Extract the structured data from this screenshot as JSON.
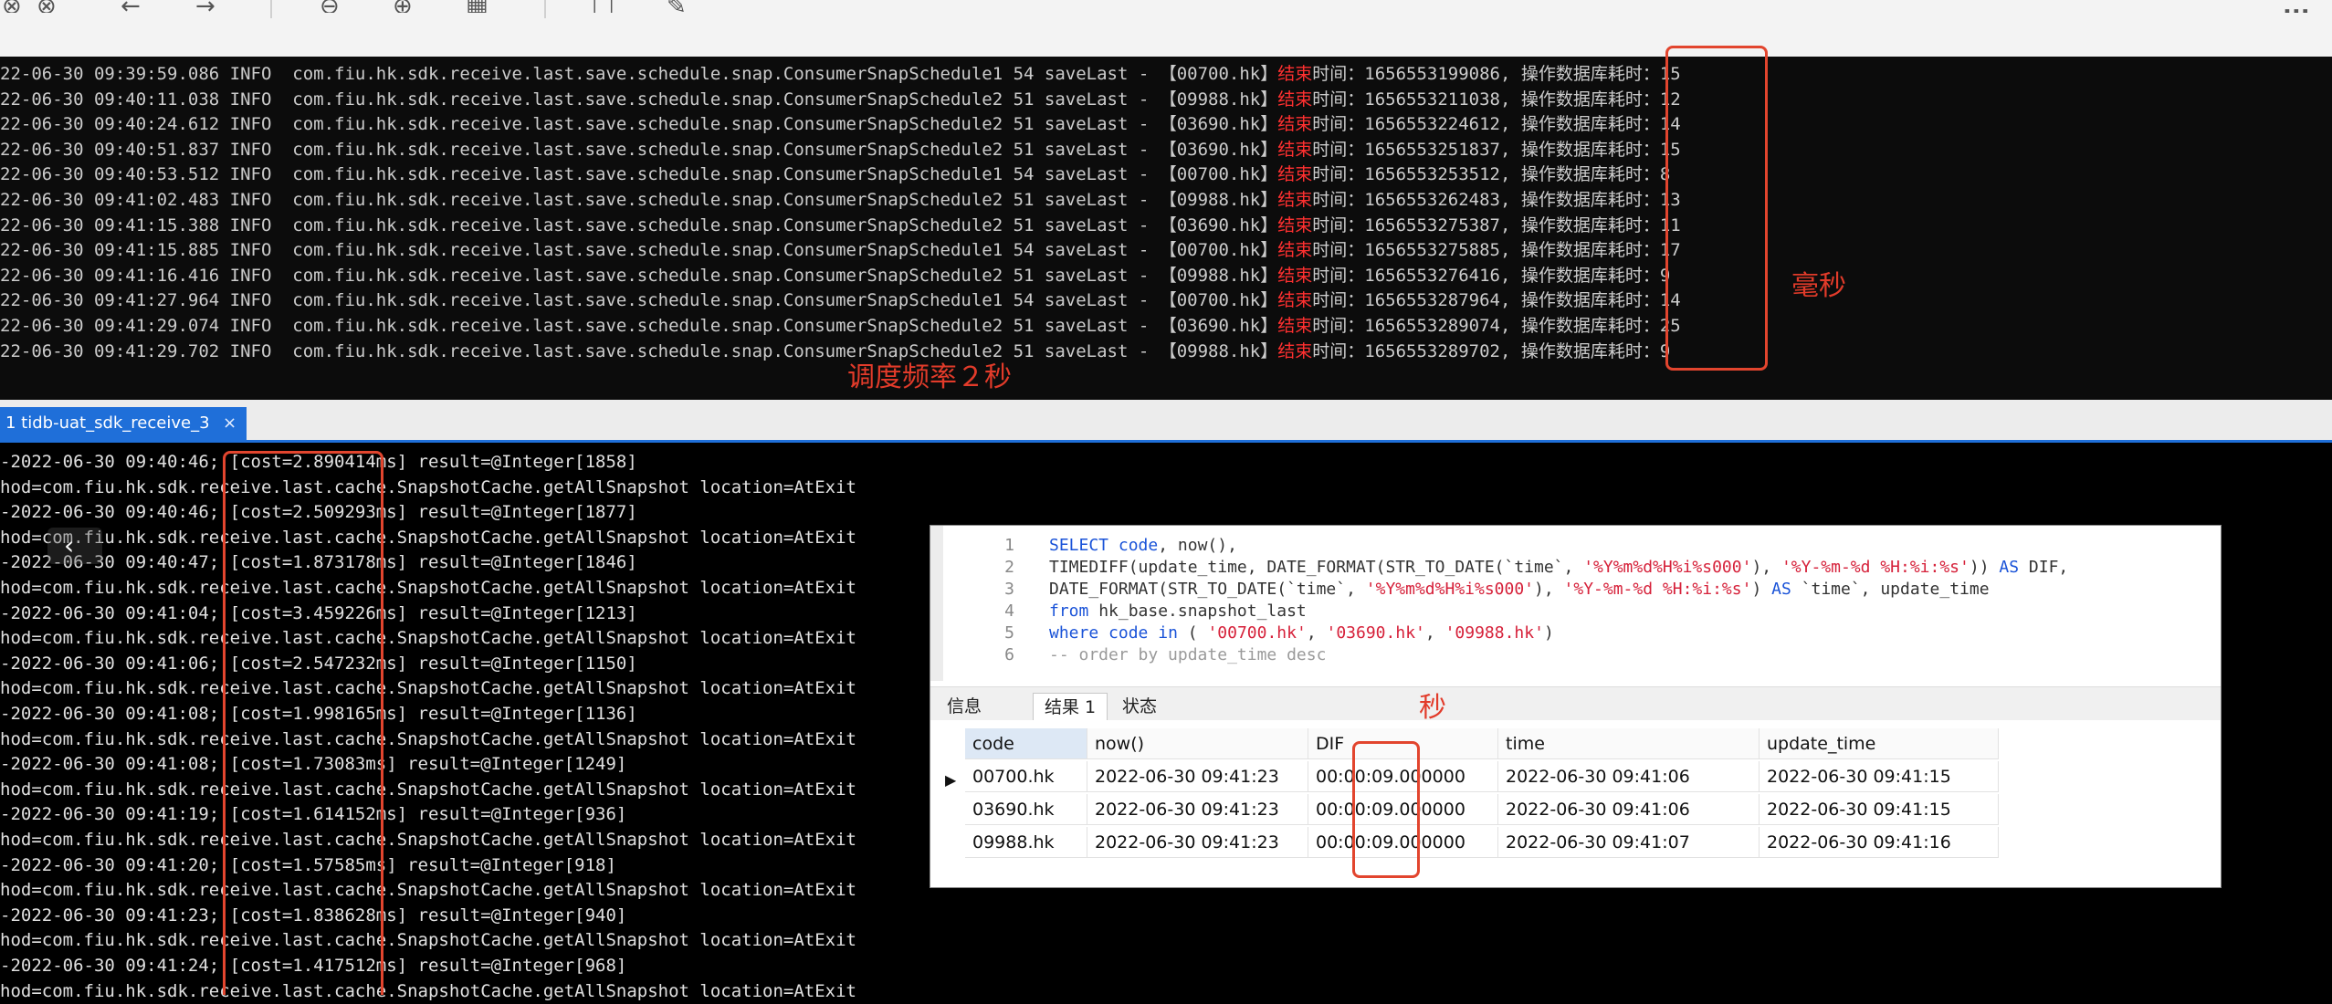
{
  "toolbar": {
    "icons": [
      "close-icon",
      "refresh-icon",
      "back-arrow-icon",
      "forward-arrow-icon",
      "zoom-out-icon",
      "zoom-in-icon",
      "grid-icon",
      "window-icon",
      "pin-icon",
      "more-icon"
    ],
    "more": "..."
  },
  "log1": {
    "rows": [
      {
        "pre": "22-06-30 09:39:59.086 INFO  com.fiu.hk.sdk.receive.last.save.schedule.snap.ConsumerSnapSchedule1 54 saveLast - 【00700.hk】",
        "red": "结束",
        "post": "时间：1656553199086, 操作数据库耗时：15"
      },
      {
        "pre": "22-06-30 09:40:11.038 INFO  com.fiu.hk.sdk.receive.last.save.schedule.snap.ConsumerSnapSchedule2 51 saveLast - 【09988.hk】",
        "red": "结束",
        "post": "时间：1656553211038, 操作数据库耗时：12"
      },
      {
        "pre": "22-06-30 09:40:24.612 INFO  com.fiu.hk.sdk.receive.last.save.schedule.snap.ConsumerSnapSchedule2 51 saveLast - 【03690.hk】",
        "red": "结束",
        "post": "时间：1656553224612, 操作数据库耗时：14"
      },
      {
        "pre": "22-06-30 09:40:51.837 INFO  com.fiu.hk.sdk.receive.last.save.schedule.snap.ConsumerSnapSchedule2 51 saveLast - 【03690.hk】",
        "red": "结束",
        "post": "时间：1656553251837, 操作数据库耗时：15"
      },
      {
        "pre": "22-06-30 09:40:53.512 INFO  com.fiu.hk.sdk.receive.last.save.schedule.snap.ConsumerSnapSchedule1 54 saveLast - 【00700.hk】",
        "red": "结束",
        "post": "时间：1656553253512, 操作数据库耗时：8"
      },
      {
        "pre": "22-06-30 09:41:02.483 INFO  com.fiu.hk.sdk.receive.last.save.schedule.snap.ConsumerSnapSchedule2 51 saveLast - 【09988.hk】",
        "red": "结束",
        "post": "时间：1656553262483, 操作数据库耗时：13"
      },
      {
        "pre": "22-06-30 09:41:15.388 INFO  com.fiu.hk.sdk.receive.last.save.schedule.snap.ConsumerSnapSchedule2 51 saveLast - 【03690.hk】",
        "red": "结束",
        "post": "时间：1656553275387, 操作数据库耗时：11"
      },
      {
        "pre": "22-06-30 09:41:15.885 INFO  com.fiu.hk.sdk.receive.last.save.schedule.snap.ConsumerSnapSchedule1 54 saveLast - 【00700.hk】",
        "red": "结束",
        "post": "时间：1656553275885, 操作数据库耗时：17"
      },
      {
        "pre": "22-06-30 09:41:16.416 INFO  com.fiu.hk.sdk.receive.last.save.schedule.snap.ConsumerSnapSchedule2 51 saveLast - 【09988.hk】",
        "red": "结束",
        "post": "时间：1656553276416, 操作数据库耗时：9"
      },
      {
        "pre": "22-06-30 09:41:27.964 INFO  com.fiu.hk.sdk.receive.last.save.schedule.snap.ConsumerSnapSchedule1 54 saveLast - 【00700.hk】",
        "red": "结束",
        "post": "时间：1656553287964, 操作数据库耗时：14"
      },
      {
        "pre": "22-06-30 09:41:29.074 INFO  com.fiu.hk.sdk.receive.last.save.schedule.snap.ConsumerSnapSchedule2 51 saveLast - 【03690.hk】",
        "red": "结束",
        "post": "时间：1656553289074, 操作数据库耗时：25"
      },
      {
        "pre": "22-06-30 09:41:29.702 INFO  com.fiu.hk.sdk.receive.last.save.schedule.snap.ConsumerSnapSchedule2 51 saveLast - 【09988.hk】",
        "red": "结束",
        "post": "时间：1656553289702, 操作数据库耗时：9"
      }
    ]
  },
  "annotations": {
    "ms": "毫秒",
    "freq": "调度频率２秒",
    "sec": "秒"
  },
  "tab": {
    "label": "1 tidb-uat_sdk_receive_3",
    "close": "×"
  },
  "log2": {
    "rows": [
      "-2022-06-30 09:40:46; [cost=2.890414ms] result=@Integer[1858]",
      "hod=com.fiu.hk.sdk.receive.last.cache.SnapshotCache.getAllSnapshot location=AtExit",
      "-2022-06-30 09:40:46; [cost=2.509293ms] result=@Integer[1877]",
      "hod=com.fiu.hk.sdk.receive.last.cache.SnapshotCache.getAllSnapshot location=AtExit",
      "-2022-06-30 09:40:47; [cost=1.873178ms] result=@Integer[1846]",
      "hod=com.fiu.hk.sdk.receive.last.cache.SnapshotCache.getAllSnapshot location=AtExit",
      "-2022-06-30 09:41:04; [cost=3.459226ms] result=@Integer[1213]",
      "hod=com.fiu.hk.sdk.receive.last.cache.SnapshotCache.getAllSnapshot location=AtExit",
      "-2022-06-30 09:41:06; [cost=2.547232ms] result=@Integer[1150]",
      "hod=com.fiu.hk.sdk.receive.last.cache.SnapshotCache.getAllSnapshot location=AtExit",
      "-2022-06-30 09:41:08; [cost=1.998165ms] result=@Integer[1136]",
      "hod=com.fiu.hk.sdk.receive.last.cache.SnapshotCache.getAllSnapshot location=AtExit",
      "-2022-06-30 09:41:08; [cost=1.73083ms] result=@Integer[1249]",
      "hod=com.fiu.hk.sdk.receive.last.cache.SnapshotCache.getAllSnapshot location=AtExit",
      "-2022-06-30 09:41:19; [cost=1.614152ms] result=@Integer[936]",
      "hod=com.fiu.hk.sdk.receive.last.cache.SnapshotCache.getAllSnapshot location=AtExit",
      "-2022-06-30 09:41:20; [cost=1.57585ms] result=@Integer[918]",
      "hod=com.fiu.hk.sdk.receive.last.cache.SnapshotCache.getAllSnapshot location=AtExit",
      "-2022-06-30 09:41:23; [cost=1.838628ms] result=@Integer[940]",
      "hod=com.fiu.hk.sdk.receive.last.cache.SnapshotCache.getAllSnapshot location=AtExit",
      "-2022-06-30 09:41:24; [cost=1.417512ms] result=@Integer[968]",
      "hod=com.fiu.hk.sdk.receive.last.cache.SnapshotCache.getAllSnapshot location=AtExit"
    ]
  },
  "sql": {
    "lines": [
      [
        {
          "t": "SELECT",
          "c": "kw"
        },
        {
          "t": " "
        },
        {
          "t": "code",
          "c": "kw"
        },
        {
          "t": ", now(),"
        }
      ],
      [
        {
          "t": "TIMEDIFF(update_time, DATE_FORMAT(STR_TO_DATE(`time`, "
        },
        {
          "t": "'%Y%m%d%H%i%s000'",
          "c": "st"
        },
        {
          "t": "), "
        },
        {
          "t": "'%Y-%m-%d %H:%i:%s'",
          "c": "st"
        },
        {
          "t": ")) "
        },
        {
          "t": "AS",
          "c": "kw"
        },
        {
          "t": " DIF,"
        }
      ],
      [
        {
          "t": "DATE_FORMAT(STR_TO_DATE(`time`, "
        },
        {
          "t": "'%Y%m%d%H%i%s000'",
          "c": "st"
        },
        {
          "t": "), "
        },
        {
          "t": "'%Y-%m-%d %H:%i:%s'",
          "c": "st"
        },
        {
          "t": ") "
        },
        {
          "t": "AS",
          "c": "kw"
        },
        {
          "t": " `time`, update_time"
        }
      ],
      [
        {
          "t": "from",
          "c": "kw"
        },
        {
          "t": " hk_base.snapshot_last"
        }
      ],
      [
        {
          "t": "where",
          "c": "kw"
        },
        {
          "t": " "
        },
        {
          "t": "code",
          "c": "kw"
        },
        {
          "t": " "
        },
        {
          "t": "in",
          "c": "kw"
        },
        {
          "t": " ( "
        },
        {
          "t": "'00700.hk'",
          "c": "st"
        },
        {
          "t": ", "
        },
        {
          "t": "'03690.hk'",
          "c": "st"
        },
        {
          "t": ", "
        },
        {
          "t": "'09988.hk'",
          "c": "st"
        },
        {
          "t": ")"
        }
      ],
      [
        {
          "t": "-- order by update_time desc",
          "c": "cm"
        }
      ]
    ]
  },
  "result_tabs": [
    "信息",
    "结果 1",
    "状态"
  ],
  "grid": {
    "headers": [
      "code",
      "now()",
      "DIF",
      "time",
      "update_time"
    ],
    "rows": [
      [
        "00700.hk",
        "2022-06-30 09:41:23",
        "00:00:09.000000",
        "2022-06-30 09:41:06",
        "2022-06-30 09:41:15"
      ],
      [
        "03690.hk",
        "2022-06-30 09:41:23",
        "00:00:09.000000",
        "2022-06-30 09:41:06",
        "2022-06-30 09:41:15"
      ],
      [
        "09988.hk",
        "2022-06-30 09:41:23",
        "00:00:09.000000",
        "2022-06-30 09:41:07",
        "2022-06-30 09:41:16"
      ]
    ]
  },
  "colors": {
    "accent": "#1f6fd9",
    "annotation": "#e2452e"
  }
}
